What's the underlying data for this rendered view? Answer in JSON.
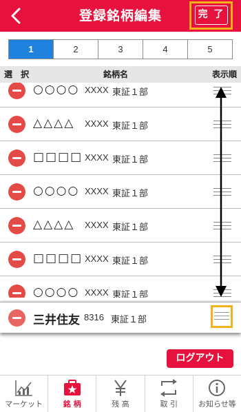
{
  "header": {
    "title": "登録銘柄編集",
    "done_label": "完 了"
  },
  "pager": [
    "1",
    "2",
    "3",
    "4",
    "5"
  ],
  "pager_active": "1",
  "columns": {
    "select": "選 択",
    "name": "銘柄名",
    "order": "表示順"
  },
  "rows": [
    {
      "symbol": "○○○○",
      "code": "XXXX",
      "market": "東証１部"
    },
    {
      "symbol": "△△△△",
      "code": "XXXX",
      "market": "東証１部"
    },
    {
      "symbol": "□□□□",
      "code": "XXXX",
      "market": "東証１部"
    },
    {
      "symbol": "○○○○",
      "code": "XXXX",
      "market": "東証１部"
    },
    {
      "symbol": "△△△△",
      "code": "XXXX",
      "market": "東証１部"
    },
    {
      "symbol": "□□□□",
      "code": "XXXX",
      "market": "東証１部"
    },
    {
      "symbol": "○○○○",
      "code": "XXXX",
      "market": "東証１部"
    }
  ],
  "dragging_row": {
    "name": "三井住友",
    "code": "8316",
    "market": "東証１部"
  },
  "logout_label": "ログアウト",
  "tabs": [
    {
      "label": "マーケット",
      "icon": "chart-icon"
    },
    {
      "label": "銘 柄",
      "icon": "briefcase-star-icon"
    },
    {
      "label": "残 高",
      "icon": "yen-icon"
    },
    {
      "label": "取 引",
      "icon": "exchange-icon"
    },
    {
      "label": "お知らせ等",
      "icon": "info-icon"
    }
  ],
  "active_tab": "銘 柄",
  "colors": {
    "brand_red": "#e6123d",
    "pager_active": "#1f82de",
    "highlight": "#f3b21c",
    "delete": "#e44b47"
  }
}
